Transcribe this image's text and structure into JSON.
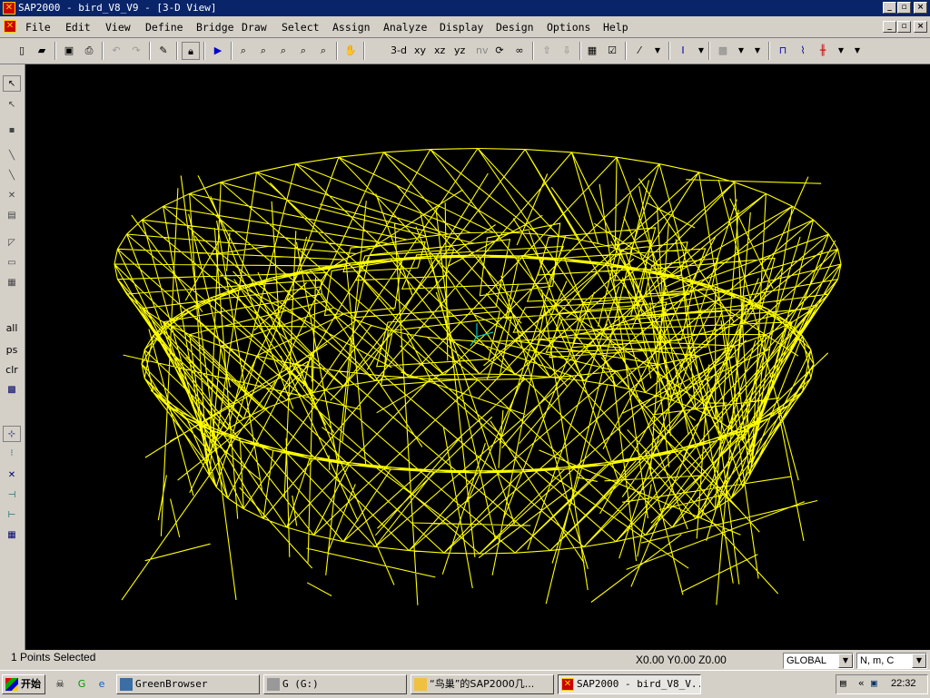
{
  "window": {
    "title": "SAP2000 - bird_V8_V9 - [3-D View]",
    "controls": [
      "_",
      "▫",
      "×"
    ]
  },
  "menu": [
    "File",
    "Edit",
    "View",
    "Define",
    "Bridge",
    "Draw",
    "Select",
    "Assign",
    "Analyze",
    "Display",
    "Design",
    "Options",
    "Help"
  ],
  "toolbar": {
    "view_buttons": [
      "3-d",
      "xy",
      "xz",
      "yz",
      "nv"
    ]
  },
  "left_toolbar": {
    "select_all": "all",
    "select_previous": "ps",
    "clear_selection": "clr"
  },
  "status": {
    "selection": "1 Points Selected",
    "coordinates": "X0.00  Y0.00  Z0.00",
    "coord_system": "GLOBAL",
    "units": "N, m, C"
  },
  "taskbar": {
    "start": "开始",
    "tasks": [
      "GreenBrowser",
      "G (G:)",
      "“鸟巢”的SAP2000几...",
      "SAP2000 - bird_V8_V..."
    ],
    "time": "22:32"
  },
  "colors": {
    "wireframe": "#ffff00",
    "viewport_bg": "#000000",
    "titlebar": "#0a246a"
  }
}
